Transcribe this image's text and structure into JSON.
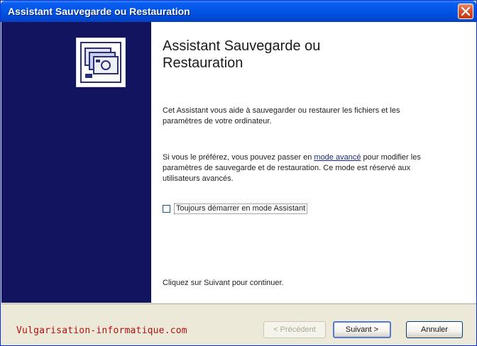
{
  "window": {
    "title": "Assistant Sauvegarde ou Restauration"
  },
  "main": {
    "heading": "Assistant Sauvegarde ou Restauration",
    "paragraph1": "Cet Assistant vous aide à sauvegarder ou restaurer les fichiers et les paramètres de votre ordinateur.",
    "paragraph2_before": "Si vous le préférez, vous pouvez passer en ",
    "paragraph2_link": "mode avancé",
    "paragraph2_after": " pour modifier les paramètres de sauvegarde et de restauration. Ce mode est réservé aux utilisateurs avancés.",
    "checkbox_label": "Toujours démarrer en mode Assistant",
    "checkbox_checked": false,
    "paragraph3": "Cliquez sur Suivant pour continuer."
  },
  "footer": {
    "watermark": "Vulgarisation-informatique.com",
    "prev_label": "< Précédent",
    "next_label": "Suivant >",
    "cancel_label": "Annuler"
  },
  "colors": {
    "side_panel": "#13145f",
    "title_bar": "#0055e5",
    "watermark": "#b01010"
  },
  "icons": [
    "close-icon",
    "backup-wizard-icon"
  ]
}
